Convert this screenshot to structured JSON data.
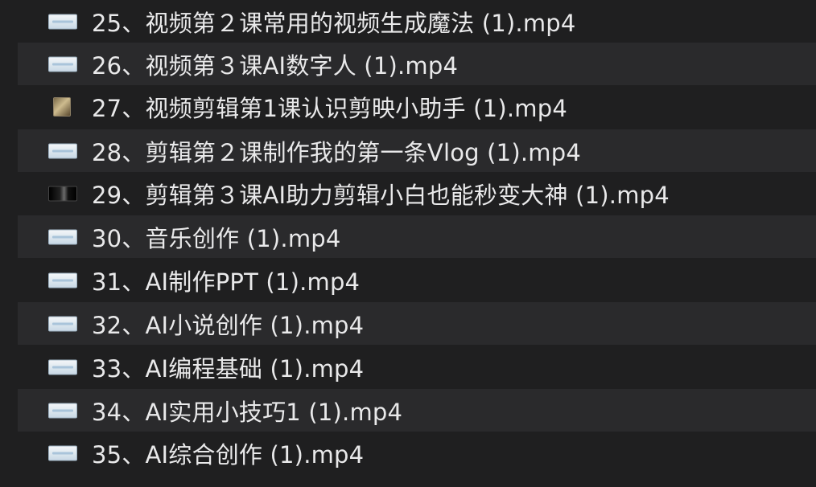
{
  "files": [
    {
      "name": "25、视频第２课常用的视频生成魔法 (1).mp4",
      "thumbnail": "light-document-thumbnail",
      "selected": false
    },
    {
      "name": "26、视频第３课AI数字人 (1).mp4",
      "thumbnail": "light-document-thumbnail",
      "selected": false
    },
    {
      "name": "27、视频剪辑第1课认识剪映小助手 (1).mp4",
      "thumbnail": "photo-thumbnail",
      "selected": false
    },
    {
      "name": "28、剪辑第２课制作我的第一条Vlog (1).mp4",
      "thumbnail": "light-document-thumbnail",
      "selected": false
    },
    {
      "name": "29、剪辑第３课AI助力剪辑小白也能秒变大神 (1).mp4",
      "thumbnail": "dark-video-thumbnail",
      "selected": false
    },
    {
      "name": "30、音乐创作 (1).mp4",
      "thumbnail": "light-document-thumbnail",
      "selected": false
    },
    {
      "name": "31、AI制作PPT (1).mp4",
      "thumbnail": "light-document-thumbnail",
      "selected": false
    },
    {
      "name": "32、AI小说创作 (1).mp4",
      "thumbnail": "light-document-thumbnail",
      "selected": false
    },
    {
      "name": "33、AI编程基础 (1).mp4",
      "thumbnail": "light-document-thumbnail",
      "selected": false
    },
    {
      "name": "34、AI实用小技巧1 (1).mp4",
      "thumbnail": "light-document-thumbnail",
      "selected": false
    },
    {
      "name": "35、AI综合创作 (1).mp4",
      "thumbnail": "light-document-thumbnail",
      "selected": false
    }
  ],
  "colors": {
    "background": "#1f1f20",
    "stripe": "#2a2a2c",
    "text": "#e9e9ea"
  }
}
